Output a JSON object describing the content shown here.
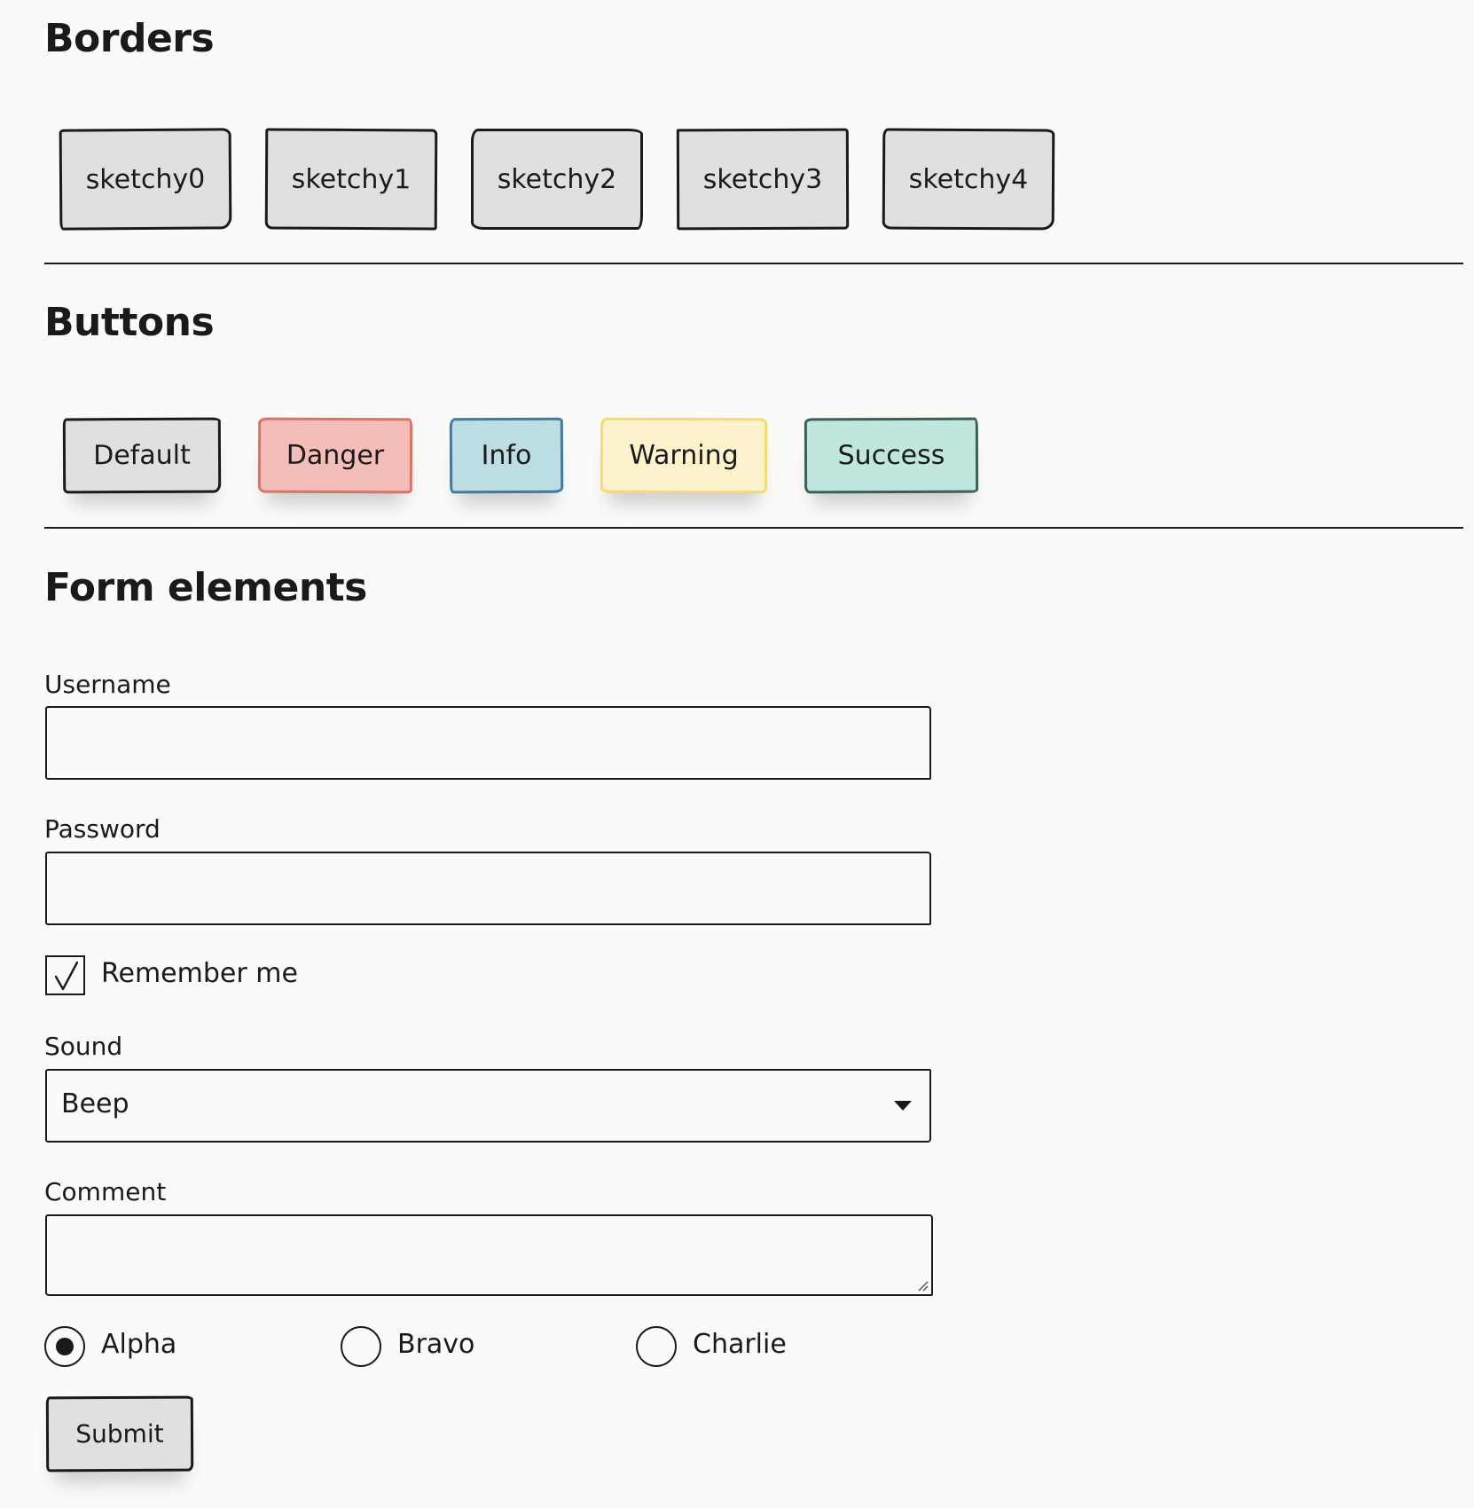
{
  "borders": {
    "title": "Borders",
    "items": [
      {
        "label": "sketchy0"
      },
      {
        "label": "sketchy1"
      },
      {
        "label": "sketchy2"
      },
      {
        "label": "sketchy3"
      },
      {
        "label": "sketchy4"
      }
    ]
  },
  "buttons": {
    "title": "Buttons",
    "items": [
      {
        "label": "Default",
        "bg": "#e0e0e0",
        "border": "#1a1a1a"
      },
      {
        "label": "Danger",
        "bg": "#f4bdb8",
        "border": "#e07068"
      },
      {
        "label": "Info",
        "bg": "#bcdde2",
        "border": "#3f7aa3"
      },
      {
        "label": "Warning",
        "bg": "#fcf2cc",
        "border": "#f5db6e"
      },
      {
        "label": "Success",
        "bg": "#bfe7e0",
        "border": "#3a6156"
      }
    ]
  },
  "form": {
    "title": "Form elements",
    "username": {
      "label": "Username",
      "value": "",
      "placeholder": ""
    },
    "password": {
      "label": "Password",
      "value": "",
      "placeholder": ""
    },
    "remember": {
      "label": "Remember me",
      "checked": true,
      "icon": "checkmark-icon"
    },
    "sound": {
      "label": "Sound",
      "selected": "Beep",
      "icon": "chevron-down-icon"
    },
    "comment": {
      "label": "Comment",
      "value": ""
    },
    "radios": [
      {
        "label": "Alpha",
        "checked": true
      },
      {
        "label": "Bravo",
        "checked": false
      },
      {
        "label": "Charlie",
        "checked": false
      }
    ],
    "submit_label": "Submit"
  },
  "colors": {
    "background": "#fafaf8",
    "ink": "#1a1a1a",
    "default_fill": "#e0e0e0"
  }
}
